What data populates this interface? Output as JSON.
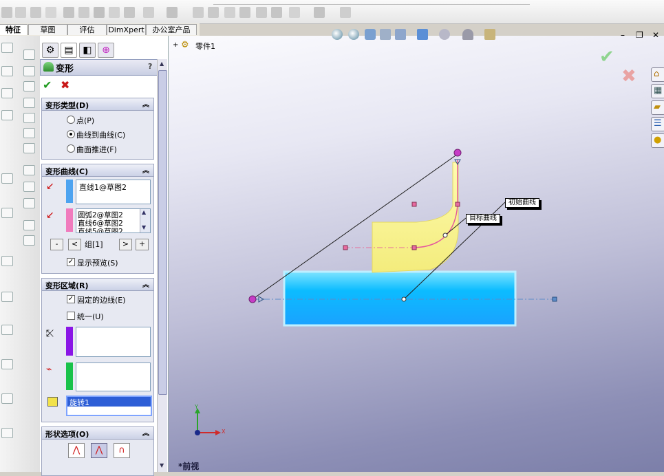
{
  "app": {
    "tab_partial": "特征"
  },
  "command_tabs": [
    {
      "label": "草图"
    },
    {
      "label": "评估"
    },
    {
      "label": "DimXpert"
    },
    {
      "label": "办公室产品"
    }
  ],
  "feature_tree": {
    "root": "零件1",
    "expand_mark": "+"
  },
  "property_manager": {
    "title": "变形",
    "help": "?",
    "ok_glyph": "✔",
    "cancel_glyph": "✖",
    "tab_icons": [
      "feature-manager-icon",
      "property-manager-icon",
      "configuration-manager-icon",
      "dimxpert-manager-icon"
    ],
    "deform_type": {
      "header": "变形类型(D)",
      "options": [
        "点(P)",
        "曲线到曲线(C)",
        "曲面推进(F)"
      ],
      "selected": "曲线到曲线(C)"
    },
    "deform_curves": {
      "header": "变形曲线(C)",
      "initial_curves": [
        "直线1@草图2"
      ],
      "target_curves": [
        "圆弧2@草图2",
        "直线6@草图2",
        "直线5@草图2"
      ],
      "group_label": "组[1]",
      "buttons": {
        "remove": "-",
        "prev": "<",
        "next": ">",
        "add": "+"
      },
      "show_preview": "显示预览(S)",
      "show_preview_checked": true,
      "initial_color": "#4da3f0",
      "target_color": "#f07bbd"
    },
    "deform_region": {
      "header": "变形区域(R)",
      "fixed_edges": "固定的边线(E)",
      "fixed_edges_checked": true,
      "uniform": "统一(U)",
      "uniform_checked": false,
      "fixed_color": "#8a16e6",
      "extra_color": "#19c24a",
      "body_selected": "旋转1"
    },
    "shape_options": {
      "header": "形状选项(O)"
    }
  },
  "viewport": {
    "callout_initial": "初始曲线",
    "callout_target": "目标曲线",
    "view_name": "*前视",
    "triad": {
      "x": "X",
      "y": "Y"
    },
    "window_controls": {
      "minimize": "–",
      "restore": "❐",
      "close": "✕"
    }
  }
}
